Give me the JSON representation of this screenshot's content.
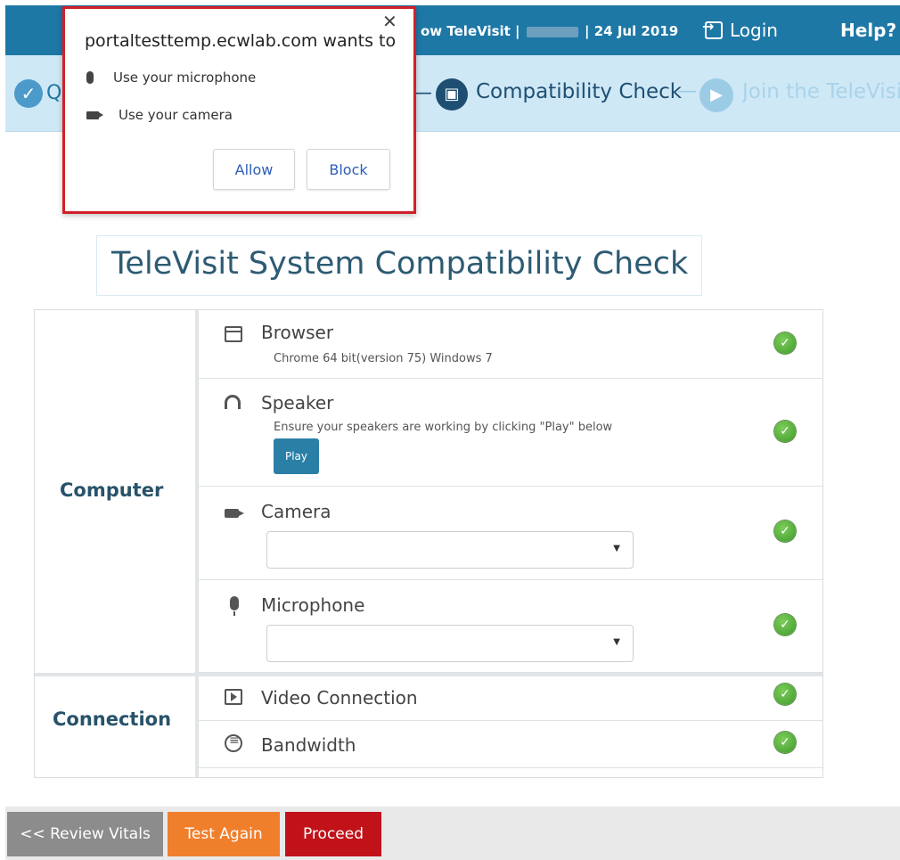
{
  "header": {
    "visit_prefix": "ow TeleVisit |",
    "visit_date": "| 24 Jul 2019",
    "login_label": "Login",
    "help_label": "Help?"
  },
  "steps": {
    "first_label": "Q",
    "compat_label": "Compatibility Check",
    "dash": "—",
    "join_label": "Join the TeleVisit"
  },
  "page_title": "TeleVisit System Compatibility Check",
  "groups": {
    "computer": "Computer",
    "connection": "Connection"
  },
  "rows": {
    "browser": {
      "name": "Browser",
      "desc": "Chrome 64 bit(version  75) Windows 7",
      "icon": "browser-icon"
    },
    "speaker": {
      "name": "Speaker",
      "desc": "Ensure your speakers are working by clicking \"Play\" below",
      "button": "Play",
      "icon": "headphones-icon"
    },
    "camera": {
      "name": "Camera",
      "selected": "",
      "icon": "camera-icon"
    },
    "microphone": {
      "name": "Microphone",
      "selected": "",
      "icon": "microphone-icon"
    },
    "video": {
      "name": "Video Connection",
      "icon": "video-icon"
    },
    "bandwidth": {
      "name": "Bandwidth",
      "icon": "bandwidth-icon"
    }
  },
  "footer": {
    "review": "<< Review Vitals",
    "again": "Test Again",
    "proceed": "Proceed"
  },
  "popup": {
    "origin": "portaltesttemp.ecwlab.com wants to",
    "perm_mic": "Use your microphone",
    "perm_cam": "Use your camera",
    "allow": "Allow",
    "block": "Block",
    "close": "✕"
  },
  "colors": {
    "header": "#1e78a6",
    "stepbar": "#cfe8f6",
    "check": "#3f9a2b",
    "proceed": "#c1121a",
    "test_again": "#f07f2c",
    "popup_border": "#d21f27"
  }
}
